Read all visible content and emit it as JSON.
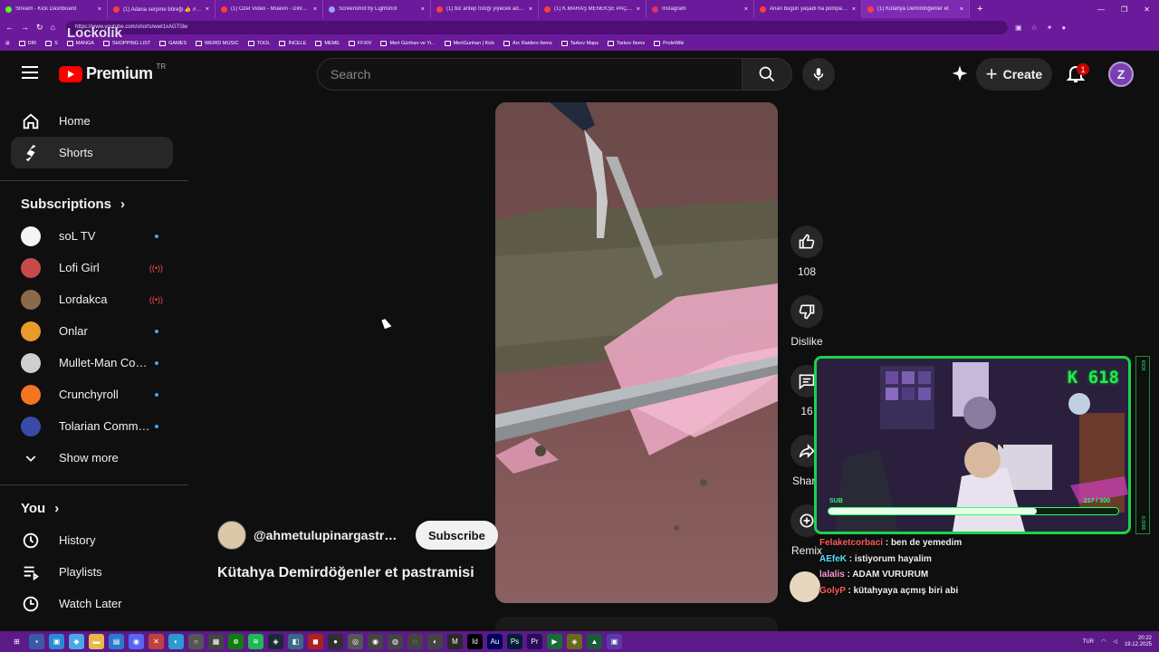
{
  "browser": {
    "tabs": [
      {
        "title": "Stream - Kick Dashboard",
        "color": "#53fc18"
      },
      {
        "title": "(1) Adana serpme böreği 👍 #böre",
        "color": "#ff3d3d"
      },
      {
        "title": "(1) Özel Video - Muavin - Dinlenme",
        "color": "#ff3d3d"
      },
      {
        "title": "Screenshot by Lightshot",
        "color": "#9aa0ff"
      },
      {
        "title": "(1) biz antep fıstığı yiyecek adam",
        "color": "#ff3d3d"
      },
      {
        "title": "(1) K.MARAŞ MENEKŞE PAÇA ÇORBA",
        "color": "#ff3d3d"
      },
      {
        "title": "Instagram",
        "color": "#e1306c"
      },
      {
        "title": "Anan bugün yaşadı ha pompa vur",
        "color": "#ff3d3d"
      },
      {
        "title": "(1) Kütahya Demirdöğenler et",
        "color": "#ff3d3d"
      }
    ],
    "url": "https://www.youtube.com/shorts/wwI1xAGTl3w",
    "overlay_logo": "Lockolik",
    "bookmarks": [
      "DIR",
      "S",
      "MANGA",
      "SHOPPING LIST",
      "GAMES",
      "WEIRD MUSIC",
      "TOOL",
      "İNCELE",
      "MEME",
      "FFXIV",
      "Mert Günhan ve Yi...",
      "MertGunhan | Kick",
      "Arc Raiders Items",
      "Tarkov Maps",
      "Tarkov Items",
      "ProleWiki"
    ]
  },
  "masthead": {
    "logo_text": "Premium",
    "country": "TR",
    "search_placeholder": "Search",
    "create_label": "Create",
    "notification_count": "1",
    "account_initial": "Z"
  },
  "sidebar": {
    "nav": [
      {
        "label": "Home",
        "icon": "home-icon"
      },
      {
        "label": "Shorts",
        "icon": "shorts-icon",
        "selected": true
      }
    ],
    "subscriptions_title": "Subscriptions",
    "subscriptions": [
      {
        "name": "soL TV",
        "indicator": "dot",
        "avatar_color": "#f5f5f5"
      },
      {
        "name": "Lofi Girl",
        "indicator": "live",
        "avatar_color": "#c94a4a"
      },
      {
        "name": "Lordakca",
        "indicator": "live",
        "avatar_color": "#8a6a4a"
      },
      {
        "name": "Onlar",
        "indicator": "dot",
        "avatar_color": "#e89a2a"
      },
      {
        "name": "Mullet-Man Comics",
        "indicator": "dot",
        "avatar_color": "#cfcfcf"
      },
      {
        "name": "Crunchyroll",
        "indicator": "dot",
        "avatar_color": "#f47521"
      },
      {
        "name": "Tolarian Community",
        "indicator": "dot",
        "avatar_color": "#3a4aa8"
      }
    ],
    "show_more": "Show more",
    "you_title": "You",
    "you_items": [
      {
        "label": "History",
        "icon": "history-icon"
      },
      {
        "label": "Playlists",
        "icon": "playlists-icon"
      },
      {
        "label": "Watch Later",
        "icon": "watch-later-icon"
      }
    ]
  },
  "short": {
    "channel": "@ahmetulupinargastronomi",
    "subscribe_label": "Subscribe",
    "title": "Kütahya Demirdöğenler et pastramisi",
    "likes": "108",
    "dislike_label": "Dislike",
    "comments": "16",
    "share_label": "Share",
    "remix_label": "Remix"
  },
  "stream_overlay": {
    "kick_count": "K 618",
    "sub_label": "SUB",
    "sub_count": "217 / 300",
    "sub_progress": 0.72,
    "side_text_top": "KICK",
    "side_text_bottom": "6.0000",
    "chat": [
      {
        "user": "Felaketcorbaci",
        "text": "ben de yemedim",
        "color": "#ff5a5a"
      },
      {
        "user": "AEfeK",
        "text": "istiyorum hayalim",
        "color": "#5ae0ff"
      },
      {
        "user": "lalalis",
        "text": "ADAM VURURUM",
        "color": "#ff9ad8"
      },
      {
        "user": "GolyP",
        "text": "kütahyaya açmış biri abi",
        "color": "#ff5a5a"
      }
    ]
  },
  "taskbar": {
    "language": "TUR",
    "time": "20:22",
    "date": "19.12.2025"
  }
}
